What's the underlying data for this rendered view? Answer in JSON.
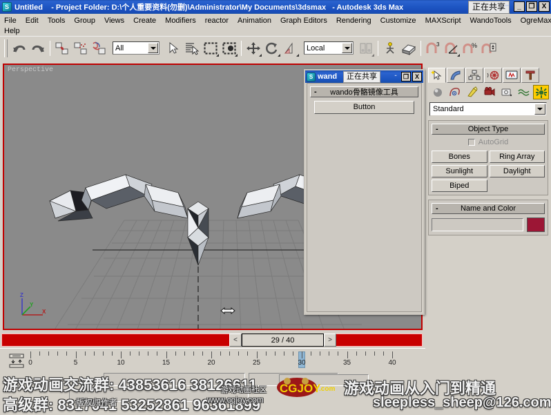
{
  "window": {
    "app_icon": "max-logo-icon",
    "title_doc": "Untitled",
    "title_project": "- Project Folder: D:\\个人重要资料(勿删)\\Administrator\\My Documents\\3dsmax",
    "title_app": "- Autodesk 3ds Max",
    "share_badge": "正在共享",
    "minimize": "_",
    "maximize": "❐",
    "close": "X"
  },
  "menubar": {
    "row1": [
      "File",
      "Edit",
      "Tools",
      "Group",
      "Views",
      "Create",
      "Modifiers",
      "reactor",
      "Animation",
      "Graph Editors",
      "Rendering",
      "Customize",
      "MAXScript",
      "WandoTools",
      "OgreMax"
    ],
    "row2": [
      "Help"
    ]
  },
  "toolbar": {
    "items": [
      {
        "name": "undo-icon",
        "label": "Undo"
      },
      {
        "name": "redo-icon",
        "label": "Redo"
      },
      {
        "name": "select-and-link-icon",
        "label": "Select and Link"
      },
      {
        "name": "unlink-selection-icon",
        "label": "Unlink Selection"
      },
      {
        "name": "bind-to-space-warp-icon",
        "label": "Bind to Space Warp"
      },
      {
        "name": "selection-filter-combo",
        "label": "All"
      },
      {
        "name": "select-object-icon",
        "label": "Select Object"
      },
      {
        "name": "select-by-name-icon",
        "label": "Select by Name"
      },
      {
        "name": "rectangular-selection-region-icon",
        "label": "Rectangular Selection Region"
      },
      {
        "name": "window-crossing-icon",
        "label": "Window/Crossing"
      },
      {
        "name": "select-and-move-icon",
        "label": "Select and Move"
      },
      {
        "name": "select-and-rotate-icon",
        "label": "Select and Rotate"
      },
      {
        "name": "select-and-scale-icon",
        "label": "Select and Uniform Scale"
      },
      {
        "name": "reference-coordinate-system-combo",
        "label": "Local"
      },
      {
        "name": "use-pivot-point-center-icon",
        "label": "Use Pivot Point Center"
      },
      {
        "name": "select-and-manipulate-icon",
        "label": "Select and Manipulate"
      },
      {
        "name": "snaps-toggle-icon",
        "label": "Snaps Toggle"
      },
      {
        "name": "snap-3d-icon",
        "label": "3"
      },
      {
        "name": "angle-snap-toggle-icon",
        "label": "Angle Snap Toggle"
      },
      {
        "name": "percent-snap-toggle-icon",
        "label": "Percent Snap Toggle"
      },
      {
        "name": "spinner-snap-toggle-icon",
        "label": "Spinner Snap Toggle"
      }
    ],
    "selection_filter": "All",
    "coord_system": "Local"
  },
  "viewport": {
    "label": "Perspective",
    "axis_z": "Z",
    "axis_y": "Y",
    "axis_x": "X"
  },
  "dialog": {
    "icon": "max-script-icon",
    "title": "wand",
    "share_badge": "正在共享",
    "minimize": "-",
    "maximize": "❐",
    "close": "X",
    "rollout_title": "wando骨骼镜像工具",
    "rollout_minus": "-",
    "button_label": "Button"
  },
  "command_panel": {
    "tabs": [
      {
        "name": "create-tab",
        "label": "Create"
      },
      {
        "name": "modify-tab",
        "label": "Modify"
      },
      {
        "name": "hierarchy-tab",
        "label": "Hierarchy"
      },
      {
        "name": "motion-tab",
        "label": "Motion"
      },
      {
        "name": "display-tab",
        "label": "Display"
      },
      {
        "name": "utilities-tab",
        "label": "Utilities"
      }
    ],
    "active_tab": "create-tab",
    "categories": [
      {
        "name": "geometry-category",
        "label": "Geometry"
      },
      {
        "name": "shapes-category",
        "label": "Shapes"
      },
      {
        "name": "lights-category",
        "label": "Lights"
      },
      {
        "name": "cameras-category",
        "label": "Cameras"
      },
      {
        "name": "helpers-category",
        "label": "Helpers"
      },
      {
        "name": "space-warps-category",
        "label": "Space Warps"
      },
      {
        "name": "systems-category",
        "label": "Systems"
      }
    ],
    "selected_category": "systems-category",
    "subcategory": "Standard",
    "object_type": {
      "title": "Object Type",
      "minus": "-",
      "autogrid_label": "AutoGrid",
      "buttons": [
        "Bones",
        "Ring Array",
        "Sunlight",
        "Daylight",
        "Biped"
      ]
    },
    "name_and_color": {
      "title": "Name and Color",
      "minus": "-",
      "name_value": "",
      "color": "#9c1635"
    }
  },
  "timeline": {
    "frame_display": "29 / 40",
    "prev_arrow": "<",
    "next_arrow": ">",
    "current_frame": 30,
    "range_start": 0,
    "range_end": 40,
    "tick_labels": [
      "0",
      "5",
      "10",
      "15",
      "20",
      "25",
      "30",
      "35",
      "40"
    ],
    "key_mode_icon": "key-mode-toggle-icon"
  },
  "watermark": {
    "line1": "游戏动画交流群: 43853616  38126611",
    "line2": "高级群: 8317041  53252861  96361899",
    "right_title": "游戏动画从入门到精通",
    "right_email": "sleepless_sheep@126.com",
    "cg_community": "游戏动画社区",
    "cg_site": "www.cgjoy.com",
    "cg_logo": "CGJOY",
    "cg_logo_suffix": ".com",
    "copyright": "版权归作者"
  }
}
